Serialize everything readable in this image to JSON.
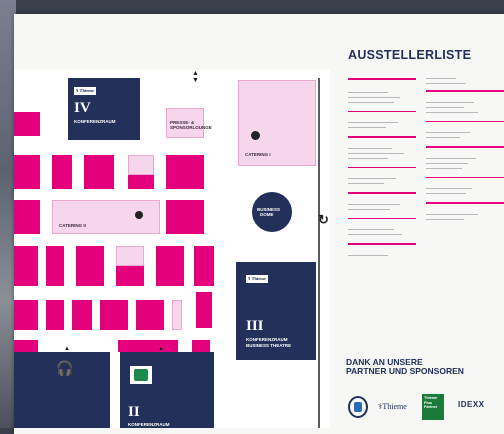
{
  "map": {
    "rooms": {
      "iv": {
        "number": "IV",
        "label": "KONFERENZRAUM",
        "sponsor": "Thieme"
      },
      "iii": {
        "number": "III",
        "label_1": "KONFERENZRAUM",
        "label_2": "BUSINESS THEATRE",
        "sponsor": "Thieme"
      },
      "ii": {
        "number": "II",
        "label": "KONFERENZRAUM"
      }
    },
    "areas": {
      "catering_1": "CATERING I",
      "catering_2": "CATERING II",
      "business_dome_1": "BUSINESS",
      "business_dome_2": "DOME",
      "presse": "PRESSE- &\nSPONSORLOUNGE"
    }
  },
  "list": {
    "title": "AUSSTELLERLISTE"
  },
  "sponsors": {
    "heading_1": "DANK AN UNSERE",
    "heading_2": "PARTNER UND SPONSOREN",
    "thieme": "Thieme",
    "partner_name_1": "Thieme",
    "partner_name_2": "Plus",
    "partner_name_3": "Partner",
    "idexx": "IDEXX"
  },
  "colors": {
    "accent": "#e4007c",
    "navy": "#23305a",
    "light_pink": "#f6d6ea"
  }
}
